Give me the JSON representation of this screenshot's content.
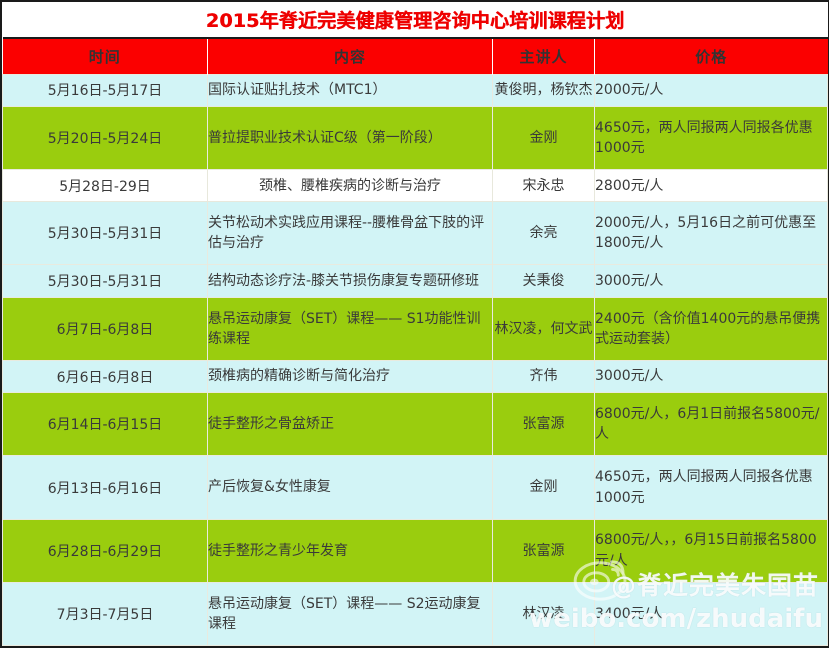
{
  "document": {
    "title": "2015年脊近完美健康管理咨询中心培训课程计划",
    "title_color": "#ee0000",
    "header_bg": "#fb0000",
    "row_tint_green": "#9acd0e",
    "row_tint_cyan": "#d2f4f6",
    "row_tint_white": "#ffffff"
  },
  "table": {
    "columns": [
      {
        "key": "time",
        "label": "时间"
      },
      {
        "key": "content",
        "label": "内容"
      },
      {
        "key": "speaker",
        "label": "主讲人"
      },
      {
        "key": "price",
        "label": "价格"
      }
    ],
    "rows": [
      {
        "tint": "cyan",
        "time": "5月16日-5月17日",
        "content": "国际认证贴扎技术（MTC1）",
        "speaker": "黄俊明，杨钦杰",
        "price": "2000元/人"
      },
      {
        "tint": "green",
        "time": "5月20日-5月24日",
        "content": "普拉提职业技术认证C级（第一阶段）",
        "speaker": "金刚",
        "price": "4650元，两人同报两人同报各优惠1000元"
      },
      {
        "tint": "white",
        "time": "5月28日-29日",
        "content": "颈椎、腰椎疾病的诊断与治疗",
        "speaker": "宋永忠",
        "price": "2800元/人"
      },
      {
        "tint": "cyan",
        "time": "5月30日-5月31日",
        "content": "关节松动术实践应用课程--腰椎骨盆下肢的评估与治疗",
        "speaker": "余亮",
        "price": "2000元/人，5月16日之前可优惠至1800元/人"
      },
      {
        "tint": "cyan",
        "time": "5月30日-5月31日",
        "content": "结构动态诊疗法-膝关节损伤康复专题研修班",
        "speaker": "关秉俊",
        "price": "3000元/人"
      },
      {
        "tint": "green",
        "time": "6月7日-6月8日",
        "content": "悬吊运动康复（SET）课程—— S1功能性训练课程",
        "speaker": "林汉凌，何文武",
        "price": "2400元（含价值1400元的悬吊便携式运动套装）"
      },
      {
        "tint": "cyan",
        "time": "6月6日-6月8日",
        "content": "颈椎病的精确诊断与简化治疗",
        "speaker": "齐伟",
        "price": "3000元/人"
      },
      {
        "tint": "green",
        "time": "6月14日-6月15日",
        "content": "徒手整形之骨盆矫正",
        "speaker": "张富源",
        "price": "6800元/人，6月1日前报名5800元/人"
      },
      {
        "tint": "cyan",
        "time": "6月13日-6月16日",
        "content": "产后恢复&女性康复",
        "speaker": "金刚",
        "price": "4650元，两人同报两人同报各优惠1000元"
      },
      {
        "tint": "green",
        "time": "6月28日-6月29日",
        "content": "徒手整形之青少年发育",
        "speaker": "张富源",
        "price": "6800元/人，，6月15日前报名5800元/人"
      },
      {
        "tint": "cyan",
        "time": "7月3日-7月5日",
        "content": "悬吊运动康复（SET）课程—— S2运动康复课程",
        "speaker": "林汉凌",
        "price": "3400元/人"
      }
    ]
  },
  "watermark": {
    "handle": "@脊近完美朱国苗",
    "url": "weibo.com/zhudaifu"
  }
}
